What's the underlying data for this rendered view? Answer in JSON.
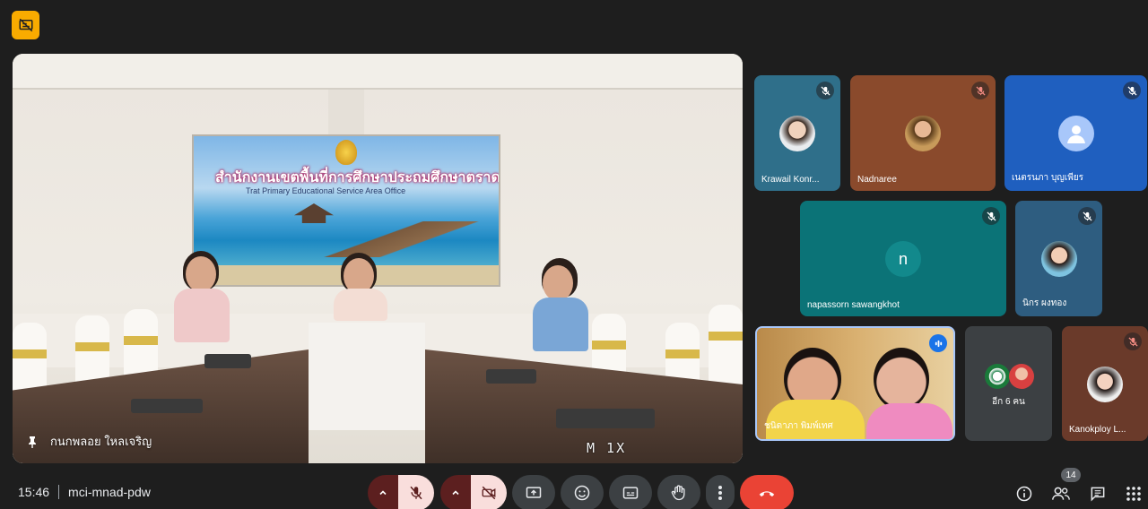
{
  "top_badge": {
    "icon": "presentation-off-icon",
    "color": "#f9ab00"
  },
  "stage": {
    "presenter_name": "กนกพลอย ใหลเจริญ",
    "pin_icon": "pin-icon",
    "banner_title": "สำนักงานเขตพื้นที่การศึกษาประถมศึกษาตราด",
    "banner_subtitle": "Trat Primary Educational Service Area Office",
    "overlay_text": "M 1X"
  },
  "participants": [
    {
      "name": "Krawail Konr...",
      "mic": "muted",
      "avatar": "photo"
    },
    {
      "name": "Nadnaree",
      "mic": "muted",
      "avatar": "photo"
    },
    {
      "name": "เนตรนภา บุญเพียร",
      "mic": "muted",
      "avatar": "default-person"
    },
    {
      "name": "napassorn sawangkhot",
      "mic": "muted",
      "avatar": "letter",
      "letter": "n"
    },
    {
      "name": "นิกร ผงทอง",
      "mic": "muted",
      "avatar": "photo"
    },
    {
      "name": "ชนิดาภา พิมพ์เทศ",
      "mic": "speaking",
      "avatar": "video"
    },
    {
      "name": "อีก 6 คน",
      "mic": "none",
      "avatar": "group"
    },
    {
      "name": "Kanokploy L...",
      "mic": "muted",
      "avatar": "photo"
    }
  ],
  "bottom_bar": {
    "time": "15:46",
    "meeting_code": "mci-mnad-pdw",
    "participant_count": "14",
    "controls": [
      "mic-options-caret",
      "mic-off-icon",
      "camera-options-caret",
      "camera-off-icon",
      "present-icon",
      "emoji-icon",
      "captions-icon",
      "raise-hand-icon",
      "more-options-icon",
      "end-call-icon"
    ],
    "right_controls": [
      "info-icon",
      "people-icon",
      "chat-icon",
      "activities-icon"
    ]
  },
  "colors": {
    "background": "#1e1e1e",
    "end_call": "#ea4335",
    "muted_button": "#f9dedc",
    "muted_caret": "#5c1f1f",
    "tile_teal": "#0b7377",
    "tile_blue": "#1a73e8",
    "speaking_border": "#a8c7fa"
  }
}
